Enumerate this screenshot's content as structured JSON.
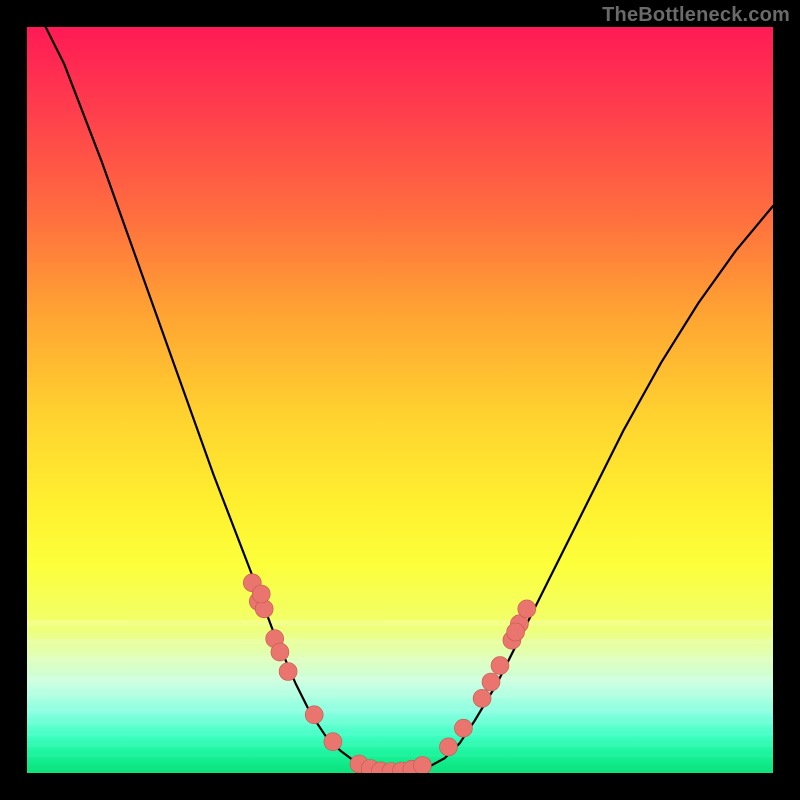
{
  "watermark": "TheBottleneck.com",
  "colors": {
    "background": "#000000",
    "watermark": "#6a6a6a",
    "curve": "#000000",
    "dot_fill": "#e9756e",
    "dot_stroke": "#c45850"
  },
  "chart_data": {
    "type": "line",
    "title": "",
    "xlabel": "",
    "ylabel": "",
    "xlim": [
      0,
      100
    ],
    "ylim": [
      0,
      100
    ],
    "x": [
      0,
      5,
      10,
      15,
      20,
      25,
      30,
      33,
      36,
      38,
      40,
      42,
      44,
      46,
      48,
      50,
      52,
      54,
      56,
      58,
      60,
      63,
      66,
      70,
      75,
      80,
      85,
      90,
      95,
      100
    ],
    "values": [
      105,
      95,
      82,
      68,
      54,
      40,
      27,
      19,
      12,
      8,
      5,
      3,
      1.5,
      0.8,
      0.4,
      0.2,
      0.4,
      0.9,
      2,
      4,
      7,
      12,
      18,
      26,
      36,
      46,
      55,
      63,
      70,
      76
    ],
    "annotations": {
      "dots_left_upper": [
        {
          "x": 31,
          "y": 23
        },
        {
          "x": 31.8,
          "y": 22
        },
        {
          "x": 30.2,
          "y": 25.5
        },
        {
          "x": 31.4,
          "y": 24
        }
      ],
      "dots_left_mid": [
        {
          "x": 33.2,
          "y": 18
        },
        {
          "x": 33.9,
          "y": 16.2
        },
        {
          "x": 35.0,
          "y": 13.6
        }
      ],
      "dots_left_low": [
        {
          "x": 38.5,
          "y": 7.8
        },
        {
          "x": 41.0,
          "y": 4.2
        }
      ],
      "dots_bottom": [
        {
          "x": 44.5,
          "y": 1.2
        },
        {
          "x": 46.0,
          "y": 0.6
        },
        {
          "x": 47.4,
          "y": 0.3
        },
        {
          "x": 48.8,
          "y": 0.2
        },
        {
          "x": 50.2,
          "y": 0.25
        },
        {
          "x": 51.6,
          "y": 0.5
        },
        {
          "x": 53.0,
          "y": 1.0
        }
      ],
      "dots_right_low": [
        {
          "x": 56.5,
          "y": 3.5
        },
        {
          "x": 58.5,
          "y": 6.0
        }
      ],
      "dots_right_mid": [
        {
          "x": 61.0,
          "y": 10.0
        },
        {
          "x": 62.2,
          "y": 12.2
        },
        {
          "x": 63.4,
          "y": 14.4
        }
      ],
      "dots_right_upper": [
        {
          "x": 65.0,
          "y": 17.8
        },
        {
          "x": 66.0,
          "y": 20.0
        },
        {
          "x": 65.5,
          "y": 18.9
        },
        {
          "x": 67.0,
          "y": 22.0
        }
      ]
    }
  }
}
